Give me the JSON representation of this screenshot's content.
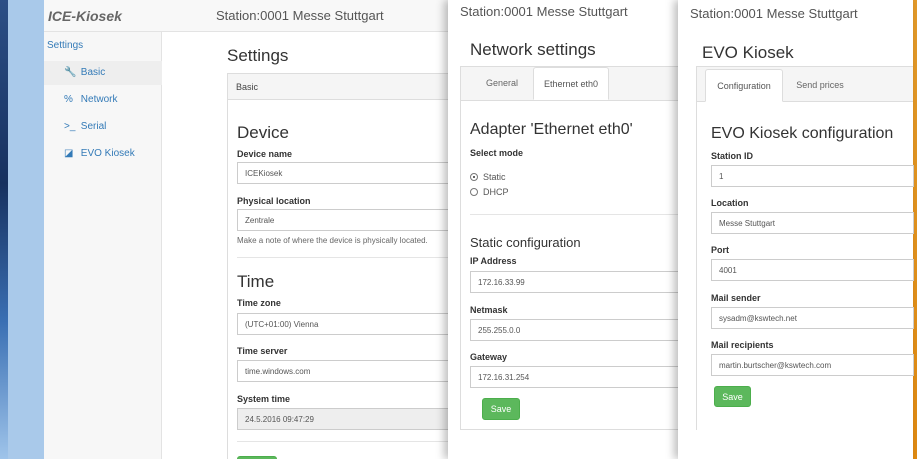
{
  "app": {
    "brand": "ICE-Kiosek",
    "station_title": "Station:0001 Messe Stuttgart"
  },
  "sidebar": {
    "header": "Settings",
    "items": [
      {
        "label": "Basic",
        "icon": "wrench-icon",
        "glyph": "🔧"
      },
      {
        "label": "Network",
        "icon": "network-icon",
        "glyph": "%"
      },
      {
        "label": "Serial",
        "icon": "terminal-icon",
        "glyph": ">_"
      },
      {
        "label": "EVO Kiosek",
        "icon": "edit-icon",
        "glyph": "◪"
      }
    ]
  },
  "settings": {
    "title": "Settings",
    "panel_title": "Basic",
    "device": {
      "heading": "Device",
      "name_label": "Device name",
      "name_value": "ICEKiosek",
      "location_label": "Physical location",
      "location_value": "Zentrale",
      "location_help": "Make a note of where the device is physically located."
    },
    "time": {
      "heading": "Time",
      "zone_label": "Time zone",
      "zone_value": "(UTC+01:00) Vienna",
      "server_label": "Time server",
      "server_value": "time.windows.com",
      "system_label": "System time",
      "system_value": "24.5.2016 09:47:29"
    }
  },
  "network": {
    "title": "Network settings",
    "tabs": [
      "General",
      "Ethernet eth0"
    ],
    "adapter_heading": "Adapter 'Ethernet eth0'",
    "mode_label": "Select mode",
    "modes": [
      "Static",
      "DHCP"
    ],
    "selected_mode": "Static",
    "static_heading": "Static configuration",
    "ip_label": "IP Address",
    "ip_value": "172.16.33.99",
    "netmask_label": "Netmask",
    "netmask_value": "255.255.0.0",
    "gateway_label": "Gateway",
    "gateway_value": "172.16.31.254",
    "save_label": "Save"
  },
  "evo": {
    "title": "EVO Kiosek",
    "tabs": [
      "Configuration",
      "Send prices"
    ],
    "heading": "EVO Kiosek configuration",
    "station_id_label": "Station ID",
    "station_id_value": "1",
    "location_label": "Location",
    "location_value": "Messe Stuttgart",
    "port_label": "Port",
    "port_value": "4001",
    "mail_sender_label": "Mail sender",
    "mail_sender_value": "sysadm@kswtech.net",
    "mail_recipients_label": "Mail recipients",
    "mail_recipients_value": "martin.burtscher@kswtech.com",
    "save_label": "Save"
  },
  "colors": {
    "link": "#337ab7",
    "save": "#5cb85c",
    "sidebar_strip": "#a9c9ea",
    "desktop_accent": "#e08a12"
  }
}
